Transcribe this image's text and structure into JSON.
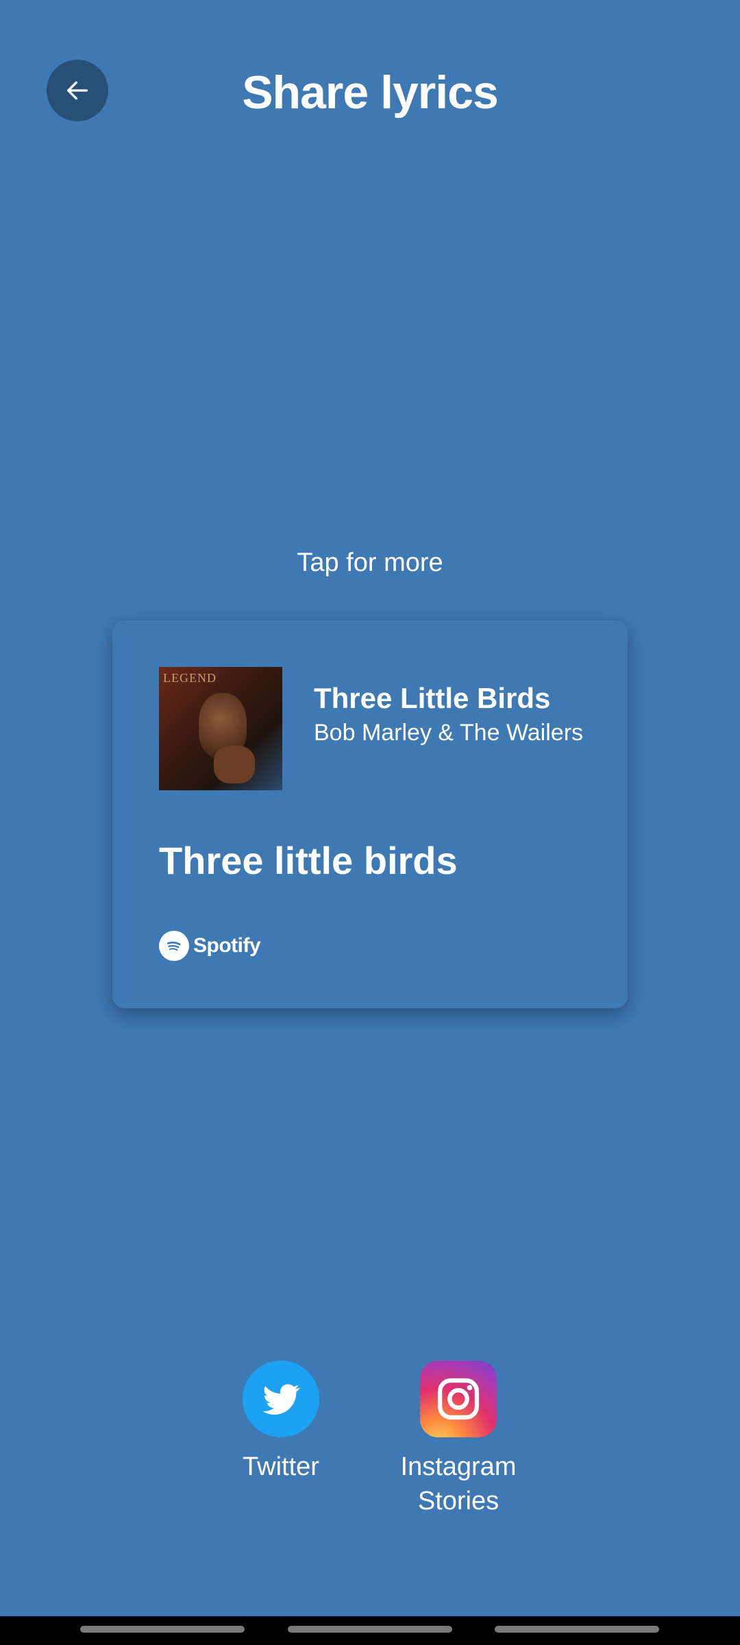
{
  "header": {
    "title": "Share lyrics",
    "back_icon": "arrow-left-icon"
  },
  "hint": {
    "text": "Tap for more"
  },
  "card": {
    "song_title": "Three Little Birds",
    "artist": "Bob Marley & The Wailers",
    "lyric": "Three little birds",
    "album_art_text": "LEGEND",
    "brand": "Spotify",
    "brand_icon": "spotify-icon"
  },
  "share_targets": [
    {
      "label": "Twitter",
      "icon": "twitter-icon",
      "color": "#1da1f2"
    },
    {
      "label": "Instagram Stories",
      "icon": "instagram-icon",
      "color": "#e1306c"
    }
  ],
  "colors": {
    "background": "#3f79b4",
    "back_button": "#284f75"
  }
}
